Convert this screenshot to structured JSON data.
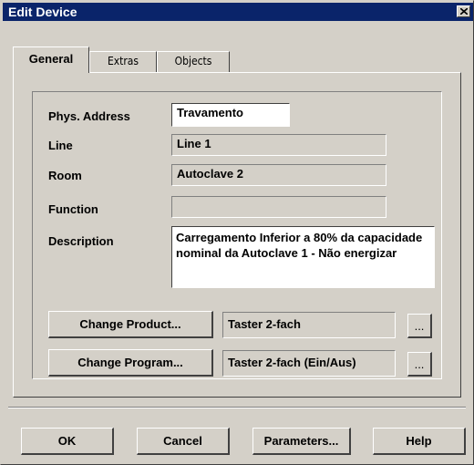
{
  "window": {
    "title": "Edit Device"
  },
  "tabs": [
    {
      "label": "General",
      "active": true
    },
    {
      "label": "Extras",
      "active": false
    },
    {
      "label": "Objects",
      "active": false
    }
  ],
  "form": {
    "phys_address": {
      "label": "Phys. Address",
      "value": "Travamento"
    },
    "line": {
      "label": "Line",
      "value": "Line 1"
    },
    "room": {
      "label": "Room",
      "value": "Autoclave 2"
    },
    "function": {
      "label": "Function",
      "value": ""
    },
    "description": {
      "label": "Description",
      "value": "Carregamento Inferior a 80% da capacidade nominal da Autoclave 1 - Não energizar"
    }
  },
  "product": {
    "button_label": "Change Product...",
    "value": "Taster 2-fach",
    "browse_label": "..."
  },
  "program": {
    "button_label": "Change Program...",
    "value": "Taster 2-fach (Ein/Aus)",
    "browse_label": "..."
  },
  "footer": {
    "ok": "OK",
    "cancel": "Cancel",
    "parameters": "Parameters...",
    "help": "Help"
  },
  "colors": {
    "titlebar": "#0a246a",
    "face": "#d4d0c8"
  }
}
